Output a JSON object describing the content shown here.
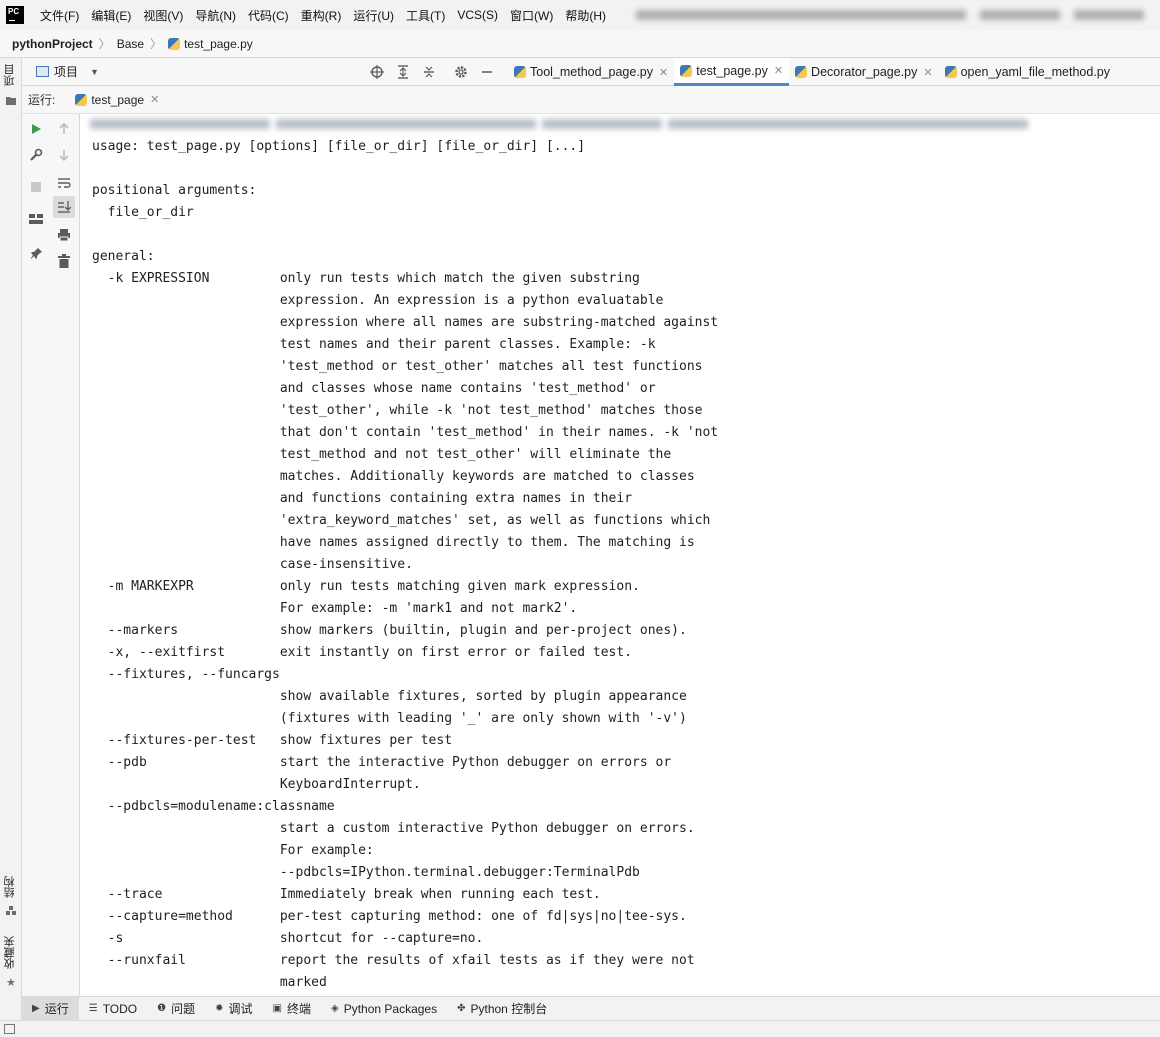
{
  "menu": {
    "items": [
      "文件(F)",
      "编辑(E)",
      "视图(V)",
      "导航(N)",
      "代码(C)",
      "重构(R)",
      "运行(U)",
      "工具(T)",
      "VCS(S)",
      "窗口(W)",
      "帮助(H)"
    ]
  },
  "breadcrumb": {
    "project": "pythonProject",
    "folder": "Base",
    "file": "test_page.py"
  },
  "left_strip": {
    "project_tab": "项目",
    "structure_tab": "结构",
    "favorites_tab": "收藏夹"
  },
  "project_panel": {
    "label": "项目"
  },
  "editor_tabs": [
    {
      "label": "Tool_method_page.py",
      "active": false
    },
    {
      "label": "test_page.py",
      "active": true
    },
    {
      "label": "Decorator_page.py",
      "active": false
    },
    {
      "label": "open_yaml_file_method.py",
      "active": false
    }
  ],
  "run_panel": {
    "label": "运行:",
    "tab": "test_page"
  },
  "console": {
    "lines": [
      "usage: test_page.py [options] [file_or_dir] [file_or_dir] [...]",
      "",
      "positional arguments:",
      "  file_or_dir",
      "",
      "general:",
      "  -k EXPRESSION         only run tests which match the given substring",
      "                        expression. An expression is a python evaluatable",
      "                        expression where all names are substring-matched against",
      "                        test names and their parent classes. Example: -k",
      "                        'test_method or test_other' matches all test functions",
      "                        and classes whose name contains 'test_method' or",
      "                        'test_other', while -k 'not test_method' matches those",
      "                        that don't contain 'test_method' in their names. -k 'not",
      "                        test_method and not test_other' will eliminate the",
      "                        matches. Additionally keywords are matched to classes",
      "                        and functions containing extra names in their",
      "                        'extra_keyword_matches' set, as well as functions which",
      "                        have names assigned directly to them. The matching is",
      "                        case-insensitive.",
      "  -m MARKEXPR           only run tests matching given mark expression.",
      "                        For example: -m 'mark1 and not mark2'.",
      "  --markers             show markers (builtin, plugin and per-project ones).",
      "  -x, --exitfirst       exit instantly on first error or failed test.",
      "  --fixtures, --funcargs",
      "                        show available fixtures, sorted by plugin appearance",
      "                        (fixtures with leading '_' are only shown with '-v')",
      "  --fixtures-per-test   show fixtures per test",
      "  --pdb                 start the interactive Python debugger on errors or",
      "                        KeyboardInterrupt.",
      "  --pdbcls=modulename:classname",
      "                        start a custom interactive Python debugger on errors.",
      "                        For example:",
      "                        --pdbcls=IPython.terminal.debugger:TerminalPdb",
      "  --trace               Immediately break when running each test.",
      "  --capture=method      per-test capturing method: one of fd|sys|no|tee-sys.",
      "  -s                    shortcut for --capture=no.",
      "  --runxfail            report the results of xfail tests as if they were not",
      "                        marked"
    ]
  },
  "bottom_tabs": [
    {
      "label": "运行",
      "icon": "play-icon",
      "active": true
    },
    {
      "label": "TODO",
      "icon": "list-icon",
      "active": false
    },
    {
      "label": "问题",
      "icon": "info-icon",
      "active": false
    },
    {
      "label": "调试",
      "icon": "bug-icon",
      "active": false
    },
    {
      "label": "终端",
      "icon": "terminal-icon",
      "active": false
    },
    {
      "label": "Python Packages",
      "icon": "layers-icon",
      "active": false
    },
    {
      "label": "Python 控制台",
      "icon": "python-icon",
      "active": false
    }
  ],
  "colors": {
    "run_green": "#3d9a50",
    "active_tab_underline": "#4a88c7"
  }
}
